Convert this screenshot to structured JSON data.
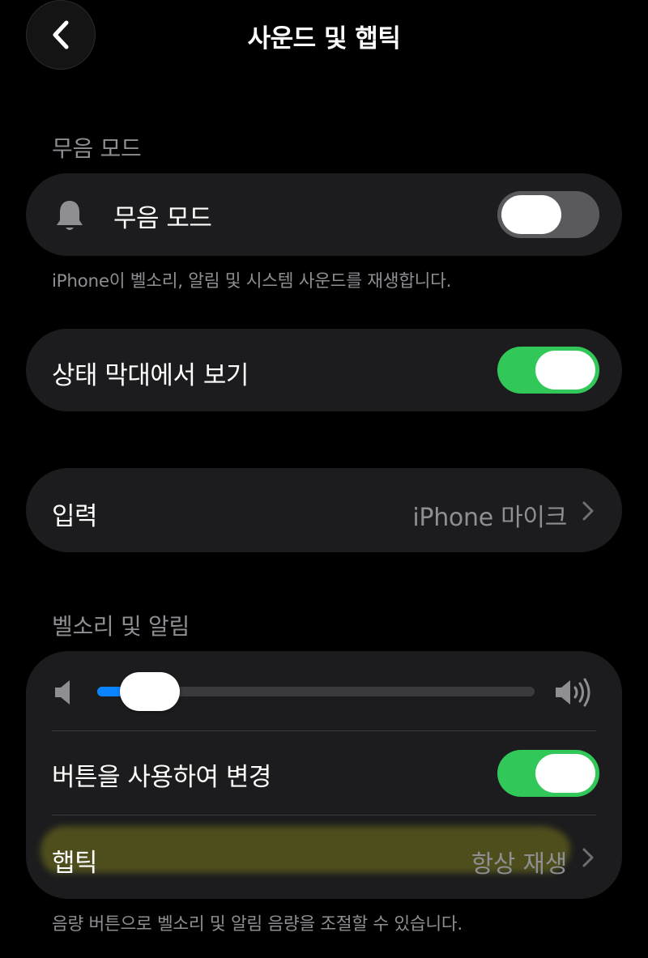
{
  "nav": {
    "title": "사운드 및 햅틱",
    "back_icon": "chevron-left-icon"
  },
  "silent_section": {
    "header": "무음 모드",
    "row_label": "무음 모드",
    "row_icon": "bell-icon",
    "toggle_on": false,
    "footnote": "iPhone이 벨소리, 알림 및 시스템 사운드를 재생합니다."
  },
  "status_bar": {
    "row_label": "상태 막대에서 보기",
    "toggle_on": true
  },
  "input": {
    "row_label": "입력",
    "value": "iPhone 마이크"
  },
  "ringtone_section": {
    "header": "벨소리 및 알림",
    "volume_level": 0.12,
    "change_with_buttons_label": "버튼을 사용하여 변경",
    "change_with_buttons_on": true,
    "haptics_label": "햅틱",
    "haptics_value": "항상 재생",
    "footnote": "음량 버튼으로 벨소리 및 알림 음량을 조절할 수 있습니다."
  },
  "colors": {
    "background": "#000000",
    "card": "#1c1c1e",
    "toggle_on": "#32c759",
    "toggle_off": "#5a5a5e",
    "slider_fill": "#0a84ff",
    "secondary_text": "#8e8e93",
    "highlight": "#78781e"
  }
}
